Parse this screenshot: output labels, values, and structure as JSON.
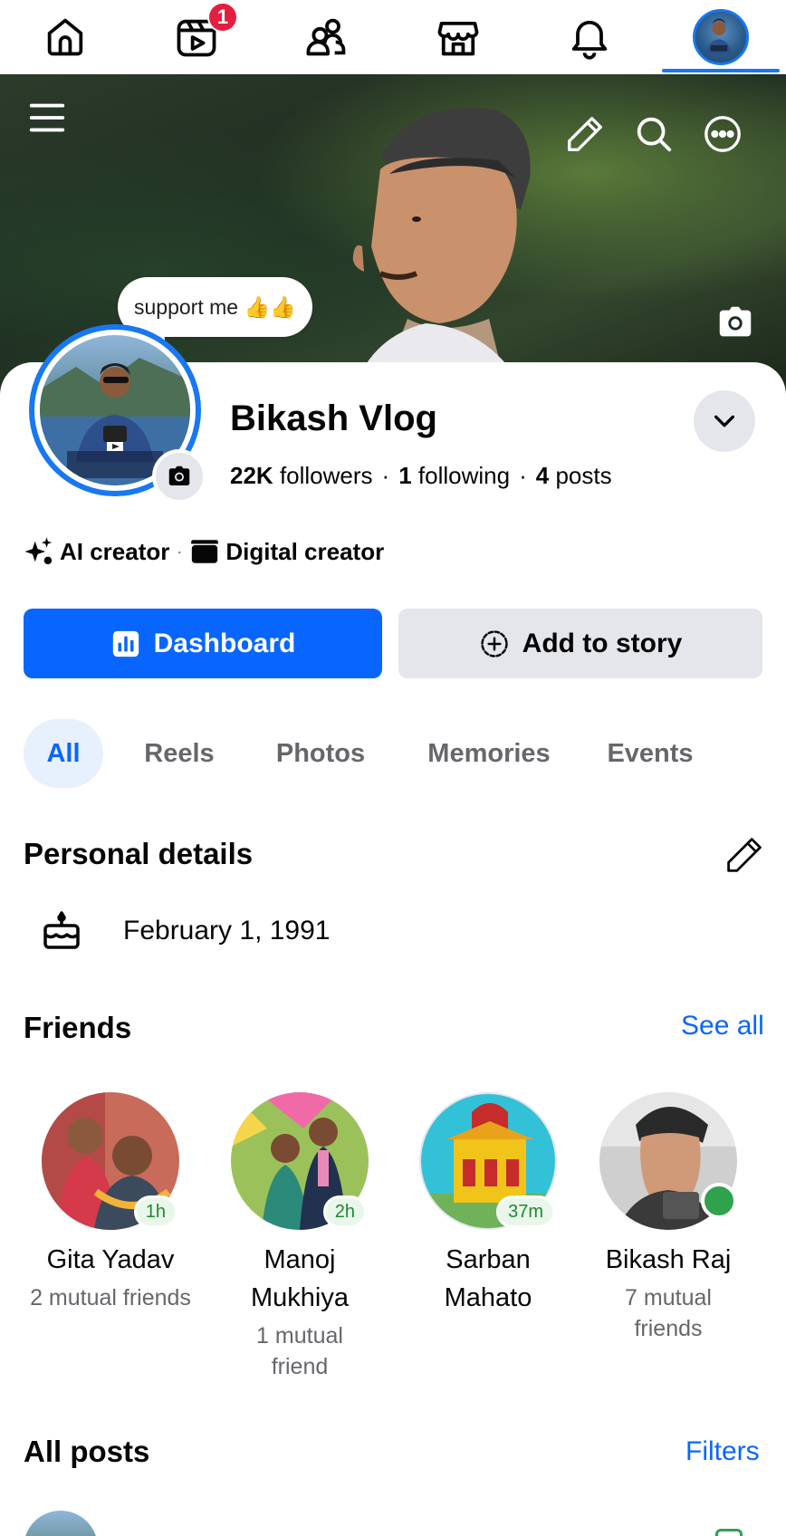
{
  "nav": {
    "items": [
      {
        "name": "home",
        "icon": "home-icon"
      },
      {
        "name": "reels",
        "icon": "reels-icon",
        "badge": "1"
      },
      {
        "name": "friends",
        "icon": "friends-icon"
      },
      {
        "name": "marketplace",
        "icon": "marketplace-icon"
      },
      {
        "name": "notifications",
        "icon": "bell-icon"
      },
      {
        "name": "profile",
        "icon": "profile-avatar"
      }
    ],
    "active": "profile",
    "accent": "#1877f2"
  },
  "cover": {
    "icons": [
      "menu-icon",
      "pencil-icon",
      "search-icon",
      "more-icon",
      "camera-icon"
    ]
  },
  "profile": {
    "note": "support me 👍👍",
    "name": "Bikash Vlog",
    "stats": {
      "followers_count": "22K",
      "followers_label": "followers",
      "following_count": "1",
      "following_label": "following",
      "posts_count": "4",
      "posts_label": "posts",
      "separator": "·"
    },
    "categories": [
      {
        "icon": "sparkle-icon",
        "label": "AI creator"
      },
      {
        "icon": "clapperboard-icon",
        "label": "Digital creator"
      }
    ],
    "category_separator": "·"
  },
  "actions": {
    "dashboard": "Dashboard",
    "add_story": "Add to story",
    "primary_color": "#0866ff"
  },
  "tabs": [
    {
      "label": "All",
      "active": true
    },
    {
      "label": "Reels",
      "active": false
    },
    {
      "label": "Photos",
      "active": false
    },
    {
      "label": "Memories",
      "active": false
    },
    {
      "label": "Events",
      "active": false
    }
  ],
  "personal_details": {
    "title": "Personal details",
    "birthday": "February 1, 1991"
  },
  "friends": {
    "title": "Friends",
    "see_all": "See all",
    "list": [
      {
        "name": "Gita Yadav",
        "mutual": "2 mutual friends",
        "badge": "1h",
        "online": false
      },
      {
        "name": "Manoj Mukhiya",
        "mutual": "1 mutual friend",
        "badge": "2h",
        "online": false
      },
      {
        "name": "Sarban Mahato",
        "mutual": "",
        "badge": "37m",
        "online": false
      },
      {
        "name": "Bikash Raj",
        "mutual": "7 mutual friends",
        "badge": "",
        "online": true
      }
    ]
  },
  "posts": {
    "title": "All posts",
    "filters": "Filters"
  }
}
